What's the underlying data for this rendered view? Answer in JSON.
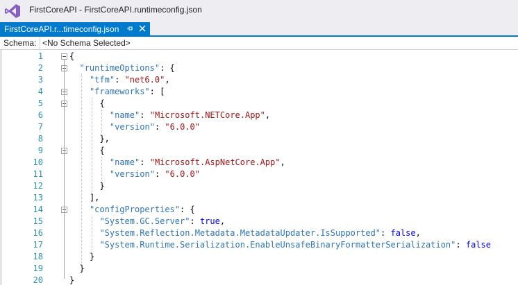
{
  "window": {
    "title": "FirstCoreAPI - FirstCoreAPI.runtimeconfig.json"
  },
  "tab": {
    "label": "FirstCoreAPI.r...timeconfig.json",
    "pin_icon": "pin-icon",
    "close_icon": "close-icon"
  },
  "schema": {
    "label": "Schema:",
    "value": "<No Schema Selected>"
  },
  "colors": {
    "accent": "#007acc",
    "line_number": "#2b91af",
    "json_key": "#2e75b6",
    "json_string": "#a31515",
    "json_keyword": "#0000ff"
  },
  "editor": {
    "lines": [
      {
        "n": "1",
        "tokens": [
          {
            "t": "p",
            "v": "{"
          }
        ]
      },
      {
        "n": "2",
        "tokens": [
          {
            "t": "k",
            "v": "\"runtimeOptions\""
          },
          {
            "t": "p",
            "v": ": {"
          }
        ]
      },
      {
        "n": "3",
        "tokens": [
          {
            "t": "k",
            "v": "\"tfm\""
          },
          {
            "t": "p",
            "v": ": "
          },
          {
            "t": "s",
            "v": "\"net6.0\""
          },
          {
            "t": "p",
            "v": ","
          }
        ]
      },
      {
        "n": "4",
        "tokens": [
          {
            "t": "k",
            "v": "\"frameworks\""
          },
          {
            "t": "p",
            "v": ": ["
          }
        ]
      },
      {
        "n": "5",
        "tokens": [
          {
            "t": "p",
            "v": "{"
          }
        ]
      },
      {
        "n": "6",
        "tokens": [
          {
            "t": "k",
            "v": "\"name\""
          },
          {
            "t": "p",
            "v": ": "
          },
          {
            "t": "s",
            "v": "\"Microsoft.NETCore.App\""
          },
          {
            "t": "p",
            "v": ","
          }
        ]
      },
      {
        "n": "7",
        "tokens": [
          {
            "t": "k",
            "v": "\"version\""
          },
          {
            "t": "p",
            "v": ": "
          },
          {
            "t": "s",
            "v": "\"6.0.0\""
          }
        ]
      },
      {
        "n": "8",
        "tokens": [
          {
            "t": "p",
            "v": "},"
          }
        ]
      },
      {
        "n": "9",
        "tokens": [
          {
            "t": "p",
            "v": "{"
          }
        ]
      },
      {
        "n": "10",
        "tokens": [
          {
            "t": "k",
            "v": "\"name\""
          },
          {
            "t": "p",
            "v": ": "
          },
          {
            "t": "s",
            "v": "\"Microsoft.AspNetCore.App\""
          },
          {
            "t": "p",
            "v": ","
          }
        ]
      },
      {
        "n": "11",
        "tokens": [
          {
            "t": "k",
            "v": "\"version\""
          },
          {
            "t": "p",
            "v": ": "
          },
          {
            "t": "s",
            "v": "\"6.0.0\""
          }
        ]
      },
      {
        "n": "12",
        "tokens": [
          {
            "t": "p",
            "v": "}"
          }
        ]
      },
      {
        "n": "13",
        "tokens": [
          {
            "t": "p",
            "v": "],"
          }
        ]
      },
      {
        "n": "14",
        "tokens": [
          {
            "t": "k",
            "v": "\"configProperties\""
          },
          {
            "t": "p",
            "v": ": {"
          }
        ]
      },
      {
        "n": "15",
        "tokens": [
          {
            "t": "k",
            "v": "\"System.GC.Server\""
          },
          {
            "t": "p",
            "v": ": "
          },
          {
            "t": "kw",
            "v": "true"
          },
          {
            "t": "p",
            "v": ","
          }
        ]
      },
      {
        "n": "16",
        "tokens": [
          {
            "t": "k",
            "v": "\"System.Reflection.Metadata.MetadataUpdater.IsSupported\""
          },
          {
            "t": "p",
            "v": ": "
          },
          {
            "t": "kw",
            "v": "false"
          },
          {
            "t": "p",
            "v": ","
          }
        ]
      },
      {
        "n": "17",
        "tokens": [
          {
            "t": "k",
            "v": "\"System.Runtime.Serialization.EnableUnsafeBinaryFormatterSerialization\""
          },
          {
            "t": "p",
            "v": ": "
          },
          {
            "t": "kw",
            "v": "false"
          }
        ]
      },
      {
        "n": "18",
        "tokens": [
          {
            "t": "p",
            "v": "}"
          }
        ]
      },
      {
        "n": "19",
        "tokens": [
          {
            "t": "p",
            "v": "}"
          }
        ]
      },
      {
        "n": "20",
        "tokens": [
          {
            "t": "p",
            "v": "}"
          }
        ]
      }
    ]
  }
}
